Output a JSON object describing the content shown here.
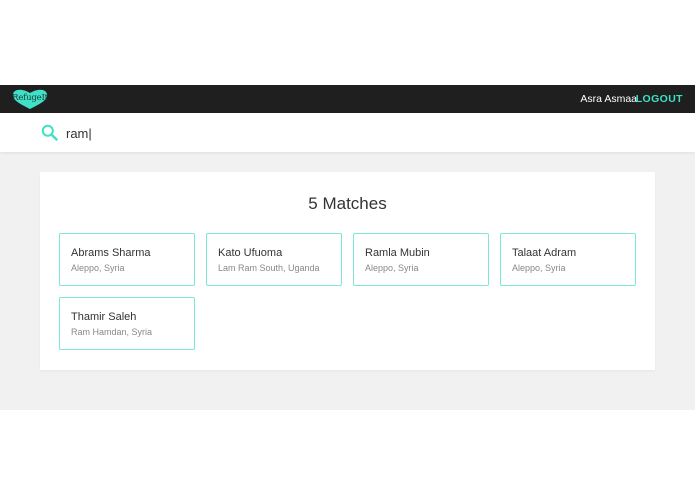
{
  "navbar": {
    "logo_text": "RefugeIt",
    "user_name": "Asra Asmaa",
    "logout_label": "LOGOUT"
  },
  "search": {
    "value": "ram|",
    "icon": "search-icon"
  },
  "results": {
    "title": "5 Matches",
    "items": [
      {
        "name": "Abrams Sharma",
        "location": "Aleppo, Syria"
      },
      {
        "name": "Kato Ufuoma",
        "location": "Lam Ram South, Uganda"
      },
      {
        "name": "Ramla Mubin",
        "location": "Aleppo, Syria"
      },
      {
        "name": "Talaat Adram",
        "location": "Aleppo, Syria"
      },
      {
        "name": "Thamir Saleh",
        "location": "Ram Hamdan, Syria"
      }
    ]
  },
  "colors": {
    "accent": "#3fe0c5",
    "navbar_bg": "#1f1f1f",
    "card_border": "#7de8d6",
    "page_bg": "#f1f1f1"
  }
}
